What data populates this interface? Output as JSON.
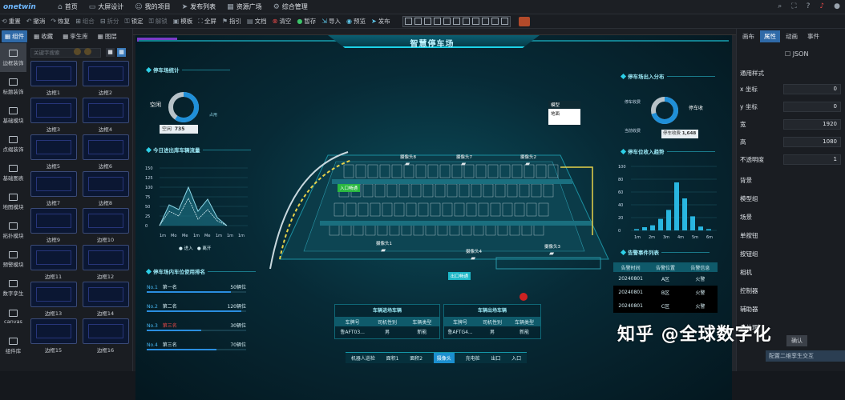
{
  "app": {
    "logo": "onetwin"
  },
  "menu": [
    {
      "icon": "home-icon",
      "label": "首页"
    },
    {
      "icon": "monitor-icon",
      "label": "大屏设计"
    },
    {
      "icon": "user-icon",
      "label": "我的项目"
    },
    {
      "icon": "send-icon",
      "label": "发布列表"
    },
    {
      "icon": "grid-icon",
      "label": "资源广场"
    },
    {
      "icon": "gear-icon",
      "label": "综合管理"
    }
  ],
  "toolbar": [
    {
      "label": "重置",
      "icon": "reset-icon",
      "state": "normal"
    },
    {
      "label": "撤消",
      "icon": "undo-icon",
      "state": "normal"
    },
    {
      "label": "恢复",
      "icon": "redo-icon",
      "state": "normal"
    },
    {
      "label": "组合",
      "icon": "group-icon",
      "state": "dim"
    },
    {
      "label": "拆分",
      "icon": "split-icon",
      "state": "dim"
    },
    {
      "label": "锁定",
      "icon": "lock-icon",
      "state": "normal"
    },
    {
      "label": "解锁",
      "icon": "unlock-icon",
      "state": "dim"
    },
    {
      "label": "模板",
      "icon": "template-icon",
      "state": "normal"
    },
    {
      "label": "全屏",
      "icon": "fullscreen-icon",
      "state": "normal"
    },
    {
      "label": "指引",
      "icon": "flag-icon",
      "state": "normal"
    },
    {
      "label": "文档",
      "icon": "doc-icon",
      "state": "normal"
    },
    {
      "label": "清空",
      "icon": "clear-icon",
      "state": "red"
    },
    {
      "label": "暂存",
      "icon": "save-icon",
      "state": "green"
    },
    {
      "label": "导入",
      "icon": "import-icon",
      "state": "cy"
    },
    {
      "label": "预览",
      "icon": "preview-icon",
      "state": "cy"
    },
    {
      "label": "发布",
      "icon": "publish-icon",
      "state": "cy"
    }
  ],
  "left": {
    "tabs": [
      "组件",
      "收藏",
      "孪生库",
      "图层"
    ],
    "categories": [
      "边框装饰",
      "标题装饰",
      "基础模块",
      "点缀装饰",
      "基础图表",
      "地图模块",
      "拓扑模块",
      "预警模块",
      "数字孪生",
      "canvas",
      "组件库"
    ],
    "search_placeholder": "关键字搜索",
    "thumbs": [
      "边框1",
      "边框2",
      "边框3",
      "边框4",
      "边框5",
      "边框6",
      "边框7",
      "边框8",
      "边框9",
      "边框10",
      "边框11",
      "边框12",
      "边框13",
      "边框14",
      "边框15",
      "边框16"
    ]
  },
  "dashboard": {
    "title": "智慧停车场",
    "space_stats": {
      "title": "停车场统计",
      "empty_label": "空闲",
      "occupied_label": "占用",
      "tooltip_label": "空闲",
      "tooltip_value": "735"
    },
    "flow": {
      "title": "今日进出库车辆流量",
      "legend": [
        "进入",
        "离开"
      ],
      "yticks": [
        "150",
        "125",
        "100",
        "75",
        "50",
        "25",
        "0"
      ],
      "xticks": [
        "1m",
        "Mo",
        "Me",
        "1m",
        "Me",
        "1m",
        "1m",
        "1m"
      ]
    },
    "rank": {
      "title": "停车场内车位使用排名",
      "rows": [
        {
          "no": "No.1",
          "name": "第一名",
          "value": "50辆位",
          "pct": 0.85
        },
        {
          "no": "No.2",
          "name": "第二名",
          "value": "120辆位",
          "pct": 0.95
        },
        {
          "no": "No.3",
          "name": "第三名",
          "value": "30辆位",
          "pct": 0.55,
          "red": true
        },
        {
          "no": "No.4",
          "name": "第三名",
          "value": "70辆位",
          "pct": 0.7
        }
      ]
    },
    "legend_box": {
      "title": "模型",
      "item": "地面"
    },
    "cameras": [
      "摄像头8",
      "摄像头7",
      "摄像头2",
      "摄像头1",
      "摄像头4",
      "摄像头3"
    ],
    "entrance": "入口畅通",
    "exit": "出口畅通",
    "inout": {
      "title": "停车场出入分布",
      "left_top": "停车收费",
      "left_bot": "当前收费",
      "right": "停车收",
      "tooltip_label": "停车收费",
      "tooltip_value": "1,648"
    },
    "revenue": {
      "title": "停车位收入趋势",
      "yticks": [
        "100",
        "80",
        "60",
        "40",
        "20",
        "0"
      ],
      "bars": [
        2,
        5,
        8,
        18,
        32,
        75,
        50,
        22,
        6,
        2
      ],
      "xlabels": [
        "1m",
        "2m",
        "3m",
        "4m",
        "5m",
        "6m"
      ]
    },
    "events": {
      "title": "告警事件列表",
      "headers": [
        "告警时间",
        "告警位置",
        "告警信息"
      ],
      "rows": [
        [
          "20240801",
          "A区",
          "火警"
        ],
        [
          "20240801",
          "B区",
          "火警"
        ],
        [
          "20240801",
          "C区",
          "火警"
        ]
      ]
    },
    "car_left": {
      "title": "车辆进场车辆",
      "headers": [
        "车牌号",
        "司机性别",
        "车辆类型"
      ],
      "row": [
        "鲁AFT03...",
        "男",
        "新能"
      ]
    },
    "car_right": {
      "title": "车辆出场车辆",
      "headers": [
        "车牌号",
        "司机性别",
        "车辆类型"
      ],
      "row": [
        "鲁AFTG4...",
        "男",
        "新能"
      ]
    },
    "nav": [
      "机器人巡检",
      "面积1",
      "面积2",
      "摄像头",
      "充电桩",
      "出口",
      "入口"
    ],
    "nav_selected": 3
  },
  "right": {
    "tabs": [
      "画布",
      "属性",
      "动画",
      "事件"
    ],
    "active_tab": 1,
    "json_label": "JSON",
    "section": "通用样式",
    "props": [
      {
        "label": "x 坐标",
        "value": "0"
      },
      {
        "label": "y 坐标",
        "value": "0"
      },
      {
        "label": "宽",
        "value": "1920"
      },
      {
        "label": "高",
        "value": "1080"
      },
      {
        "label": "不透明度",
        "value": "1"
      }
    ],
    "groups": [
      "背景",
      "模型组",
      "场景",
      "单按钮",
      "按钮组",
      "相机",
      "控制器",
      "辅助器",
      "后处理"
    ],
    "config_button": "配置二维孪生交互",
    "apply_button": "确认"
  },
  "watermark": "知乎 @全球数字化",
  "colors": {
    "accent": "#2f6aa8",
    "dash_cyan": "#1dd3e8",
    "red": "#e34848",
    "green": "#3cc46a"
  }
}
